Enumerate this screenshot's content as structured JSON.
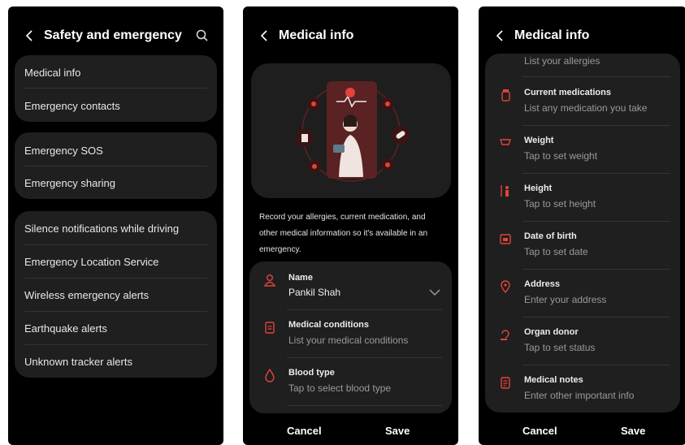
{
  "screen1": {
    "title": "Safety and emergency",
    "group1": [
      "Medical info",
      "Emergency contacts"
    ],
    "group2": [
      "Emergency SOS",
      "Emergency sharing"
    ],
    "group3": [
      "Silence notifications while driving",
      "Emergency Location Service",
      "Wireless emergency alerts",
      "Earthquake alerts",
      "Unknown tracker alerts"
    ]
  },
  "screen2": {
    "title": "Medical info",
    "description": "Record your allergies, current medication, and other medical information so it's available in an emergency.",
    "fields": [
      {
        "label": "Name",
        "value": "Pankil Shah",
        "icon": "person-icon"
      },
      {
        "label": "Medical conditions",
        "value": "List your medical conditions",
        "icon": "clipboard-icon"
      },
      {
        "label": "Blood type",
        "value": "Tap to select blood type",
        "icon": "drop-icon"
      }
    ],
    "cancel": "Cancel",
    "save": "Save"
  },
  "screen3": {
    "title": "Medical info",
    "partial_value": "List your allergies",
    "fields": [
      {
        "label": "Current medications",
        "value": "List any medication you take",
        "icon": "pill-bottle-icon"
      },
      {
        "label": "Weight",
        "value": "Tap to set weight",
        "icon": "scale-icon"
      },
      {
        "label": "Height",
        "value": "Tap to set height",
        "icon": "height-icon"
      },
      {
        "label": "Date of birth",
        "value": "Tap to set date",
        "icon": "calendar-icon"
      },
      {
        "label": "Address",
        "value": "Enter your address",
        "icon": "location-pin-icon"
      },
      {
        "label": "Organ donor",
        "value": "Tap to set status",
        "icon": "organ-donor-icon"
      },
      {
        "label": "Medical notes",
        "value": "Enter other important info",
        "icon": "notes-icon"
      }
    ],
    "cancel": "Cancel",
    "save": "Save"
  },
  "colors": {
    "accent": "#e0443a",
    "card": "#1f1f1f",
    "bg": "#000000"
  }
}
